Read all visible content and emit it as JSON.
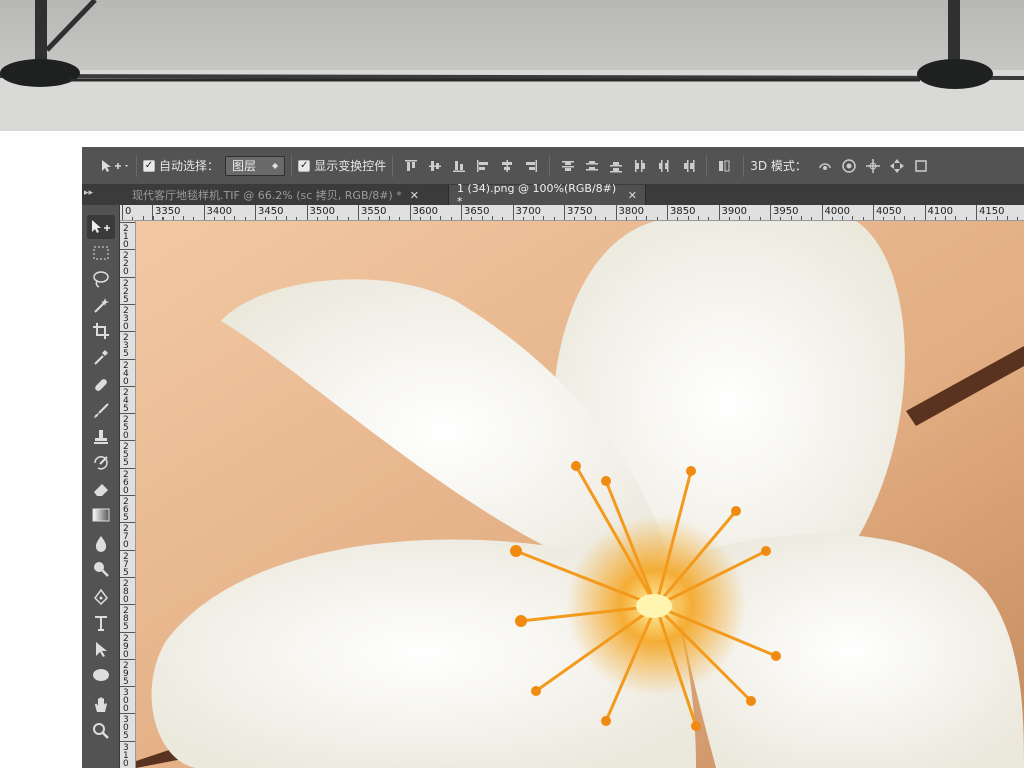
{
  "options_bar": {
    "auto_select_label": "自动选择：",
    "auto_select_checked": true,
    "auto_select_target": "图层",
    "show_transform_label": "显示变换控件",
    "show_transform_checked": true,
    "mode_3d_label": "3D 模式："
  },
  "tabs": [
    {
      "label": "现代客厅地毯样机.TIF @ 66.2% (sc 拷贝, RGB/8#) *",
      "active": false
    },
    {
      "label": "1 (34).png @ 100%(RGB/8#) *",
      "active": true
    }
  ],
  "ruler_top": {
    "labels": [
      "0",
      "3350",
      "3400",
      "3450",
      "3500",
      "3550",
      "3600",
      "3650",
      "3700",
      "3750",
      "3800",
      "3850",
      "3900",
      "3950",
      "4000",
      "4050",
      "4100",
      "4150"
    ]
  },
  "ruler_left": {
    "labels": [
      "2\n1\n0",
      "2\n2\n0",
      "2\n2\n5",
      "2\n3\n0",
      "2\n3\n5",
      "2\n4\n0",
      "2\n4\n5",
      "2\n5\n0",
      "2\n5\n5",
      "2\n6\n0",
      "2\n6\n5",
      "2\n7\n0",
      "2\n7\n5",
      "2\n8\n0",
      "2\n8\n5",
      "2\n9\n0",
      "2\n9\n5",
      "3\n0\n0",
      "3\n0\n5",
      "3\n1\n0"
    ]
  },
  "tools": [
    "move-tool",
    "marquee-tool",
    "lasso-tool",
    "magic-wand-tool",
    "crop-tool",
    "eyedropper-tool",
    "healing-brush-tool",
    "brush-tool",
    "clone-stamp-tool",
    "history-brush-tool",
    "eraser-tool",
    "gradient-tool",
    "blur-tool",
    "dodge-tool",
    "pen-tool",
    "type-tool",
    "path-selection-tool",
    "ellipse-tool",
    "hand-tool",
    "zoom-tool"
  ],
  "colors": {
    "ps_panel": "#535353",
    "tab_bar": "#3b3b3b",
    "canvas_bg": "#e8b88f",
    "petal": "#f4f2ea",
    "stamen": "#f0a020"
  }
}
